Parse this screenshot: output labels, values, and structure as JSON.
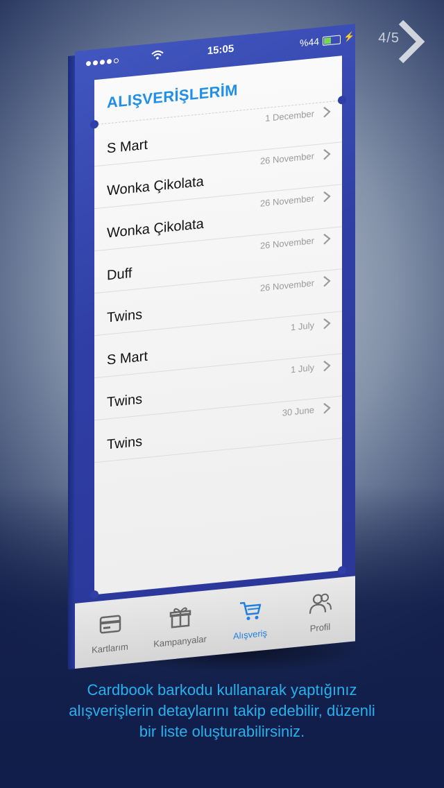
{
  "pager": {
    "indicator": "4/5"
  },
  "status_bar": {
    "time": "15:05",
    "battery": "%44",
    "battery_level": 0.44
  },
  "screen": {
    "title": "ALIŞVERİŞLERİM",
    "purchases": [
      {
        "name": "S Mart",
        "date": "1 December"
      },
      {
        "name": "Wonka Çikolata",
        "date": "26 November"
      },
      {
        "name": "Wonka Çikolata",
        "date": "26 November"
      },
      {
        "name": "Duff",
        "date": "26 November"
      },
      {
        "name": "Twins",
        "date": "26 November"
      },
      {
        "name": "S Mart",
        "date": "1 July"
      },
      {
        "name": "Twins",
        "date": "1 July"
      },
      {
        "name": "Twins",
        "date": "30 June"
      }
    ]
  },
  "tabs": {
    "items": [
      {
        "label": "Kartlarım",
        "icon": "card-icon"
      },
      {
        "label": "Kampanyalar",
        "icon": "gift-icon"
      },
      {
        "label": "Alışveriş",
        "icon": "cart-icon",
        "active": true
      },
      {
        "label": "Profil",
        "icon": "users-icon"
      }
    ]
  },
  "colors": {
    "accent": "#1f8fe8",
    "caption": "#27b1ef",
    "device": "#3445aa"
  },
  "caption": {
    "line1": "Cardbook barkodu kullanarak yaptığınız",
    "line2": "alışverişlerin detaylarını takip edebilir, düzenli",
    "line3": "bir liste oluşturabilirsiniz."
  }
}
